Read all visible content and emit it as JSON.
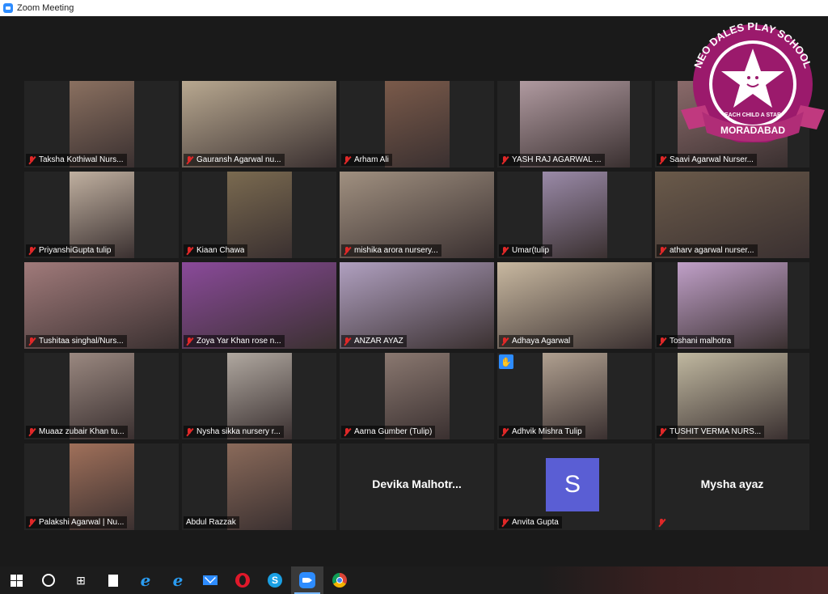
{
  "window": {
    "title": "Zoom Meeting"
  },
  "logo": {
    "top_text": "NEO DALES PLAY SCHOOL",
    "tagline": "EACH CHILD A STAR",
    "bottom_text": "MORADABAD",
    "colors": {
      "ring": "#9b1a6c",
      "ribbon": "#c0397f",
      "star": "#ffffff"
    }
  },
  "participants": [
    {
      "name": "Taksha Kothiwal Nurs...",
      "muted": true,
      "video": "narrow",
      "tint": "#8a7060"
    },
    {
      "name": "Gauransh Agarwal nu...",
      "muted": true,
      "video": "wide",
      "tint": "#b8a890"
    },
    {
      "name": "Arham Ali",
      "muted": true,
      "video": "narrow",
      "tint": "#7a5a4a"
    },
    {
      "name": "YASH RAJ AGARWAL ...",
      "muted": true,
      "video": "mid",
      "tint": "#b09aa0"
    },
    {
      "name": "Saavi Agarwal Nurser...",
      "muted": true,
      "video": "mid",
      "tint": "#8a6a6a"
    },
    {
      "name": "PriyanshiGupta tulip",
      "muted": true,
      "video": "narrow",
      "tint": "#c0b0a0"
    },
    {
      "name": "Kiaan Chawa",
      "muted": true,
      "video": "narrow",
      "tint": "#7a6a50"
    },
    {
      "name": "mishika arora nursery...",
      "muted": true,
      "video": "wide",
      "tint": "#a09080"
    },
    {
      "name": "Umar(tulip",
      "muted": true,
      "video": "narrow",
      "tint": "#9a8aa8"
    },
    {
      "name": "atharv agarwal nurser...",
      "muted": true,
      "video": "wide",
      "tint": "#6a5a4a"
    },
    {
      "name": "Tushitaa singhal/Nurs...",
      "muted": true,
      "video": "wide",
      "tint": "#a07a7a"
    },
    {
      "name": "Zoya Yar Khan rose n...",
      "muted": true,
      "video": "wide",
      "tint": "#8a4a9a"
    },
    {
      "name": "ANZAR AYAZ",
      "muted": true,
      "video": "wide",
      "tint": "#b0a0c0"
    },
    {
      "name": "Adhaya Agarwal",
      "muted": true,
      "video": "wide",
      "tint": "#c8b8a0"
    },
    {
      "name": "Toshani malhotra",
      "muted": true,
      "video": "mid",
      "tint": "#c0a0c8"
    },
    {
      "name": "Muaaz zubair Khan tu...",
      "muted": true,
      "video": "narrow",
      "tint": "#9a8880"
    },
    {
      "name": "Nysha sikka nursery r...",
      "muted": true,
      "video": "narrow",
      "tint": "#b0a8a0"
    },
    {
      "name": "Aarna Gumber (Tulip)",
      "muted": true,
      "video": "narrow",
      "tint": "#8a7870"
    },
    {
      "name": "Adhvik Mishra Tulip",
      "muted": true,
      "video": "narrow",
      "tint": "#b0a090",
      "hand_raised": true
    },
    {
      "name": "TUSHIT VERMA NURS...",
      "muted": true,
      "video": "mid",
      "tint": "#c0b8a0"
    },
    {
      "name": "Palakshi Agarwal | Nu...",
      "muted": true,
      "video": "narrow",
      "tint": "#a0705a"
    },
    {
      "name": "Abdul Razzak",
      "muted": false,
      "video": "narrow",
      "tint": "#8a6a5a"
    },
    {
      "name": "Devika  Malhotr...",
      "muted": false,
      "video": "none",
      "display": "name"
    },
    {
      "name": "Anvita Gupta",
      "muted": true,
      "video": "none",
      "display": "avatar",
      "initial": "S"
    },
    {
      "name": "Mysha ayaz",
      "muted": true,
      "video": "none",
      "display": "name-icon"
    }
  ],
  "taskbar": {
    "icons": [
      "windows-start-icon",
      "cortana-search-icon",
      "task-view-icon",
      "file-icon",
      "edge-icon",
      "ie-icon",
      "mail-icon",
      "opera-icon",
      "skype-icon",
      "zoom-icon",
      "chrome-icon"
    ],
    "skype_letter": "S",
    "ie_letter": "e"
  }
}
